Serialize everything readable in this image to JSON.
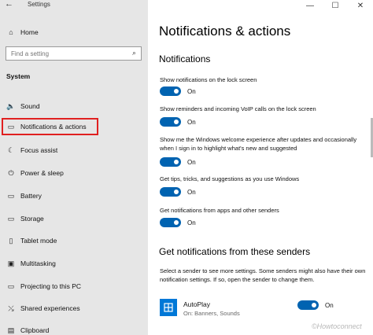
{
  "window": {
    "title": "Settings",
    "back_glyph": "←",
    "minimize_glyph": "—",
    "maximize_glyph": "☐",
    "close_glyph": "✕"
  },
  "sidebar": {
    "home_label": "Home",
    "search": {
      "placeholder": "Find a setting",
      "value": ""
    },
    "section_label": "System",
    "items": [
      {
        "label": "Sound",
        "icon": "speaker-icon",
        "glyph": "🔈"
      },
      {
        "label": "Notifications & actions",
        "icon": "notifications-icon",
        "glyph": "▭",
        "selected": true
      },
      {
        "label": "Focus assist",
        "icon": "moon-icon",
        "glyph": "☾"
      },
      {
        "label": "Power & sleep",
        "icon": "power-icon",
        "glyph": "⏻"
      },
      {
        "label": "Battery",
        "icon": "battery-icon",
        "glyph": "▭"
      },
      {
        "label": "Storage",
        "icon": "storage-icon",
        "glyph": "▭"
      },
      {
        "label": "Tablet mode",
        "icon": "tablet-icon",
        "glyph": "▯"
      },
      {
        "label": "Multitasking",
        "icon": "multitasking-icon",
        "glyph": "▣"
      },
      {
        "label": "Projecting to this PC",
        "icon": "projector-icon",
        "glyph": "▭"
      },
      {
        "label": "Shared experiences",
        "icon": "shared-icon",
        "glyph": "⤯"
      },
      {
        "label": "Clipboard",
        "icon": "clipboard-icon",
        "glyph": "▤"
      }
    ]
  },
  "main": {
    "title": "Notifications & actions",
    "notifications_heading": "Notifications",
    "settings": [
      {
        "label": "Show notifications on the lock screen",
        "state": "On"
      },
      {
        "label": "Show reminders and incoming VoIP calls on the lock screen",
        "state": "On"
      },
      {
        "label": "Show me the Windows welcome experience after updates and occasionally when I sign in to highlight what's new and suggested",
        "state": "On"
      },
      {
        "label": "Get tips, tricks, and suggestions as you use Windows",
        "state": "On"
      },
      {
        "label": "Get notifications from apps and other senders",
        "state": "On"
      }
    ],
    "senders_heading": "Get notifications from these senders",
    "senders_desc": "Select a sender to see more settings. Some senders might also have their own notification settings. If so, open the sender to change them.",
    "senders": [
      {
        "name": "AutoPlay",
        "sub": "On: Banners, Sounds",
        "state": "On"
      }
    ]
  },
  "watermark": "©Howtoconnect",
  "colors": {
    "accent": "#0063b1",
    "sidebar_bg": "#e6e6e6",
    "highlight_border": "#e02020"
  }
}
